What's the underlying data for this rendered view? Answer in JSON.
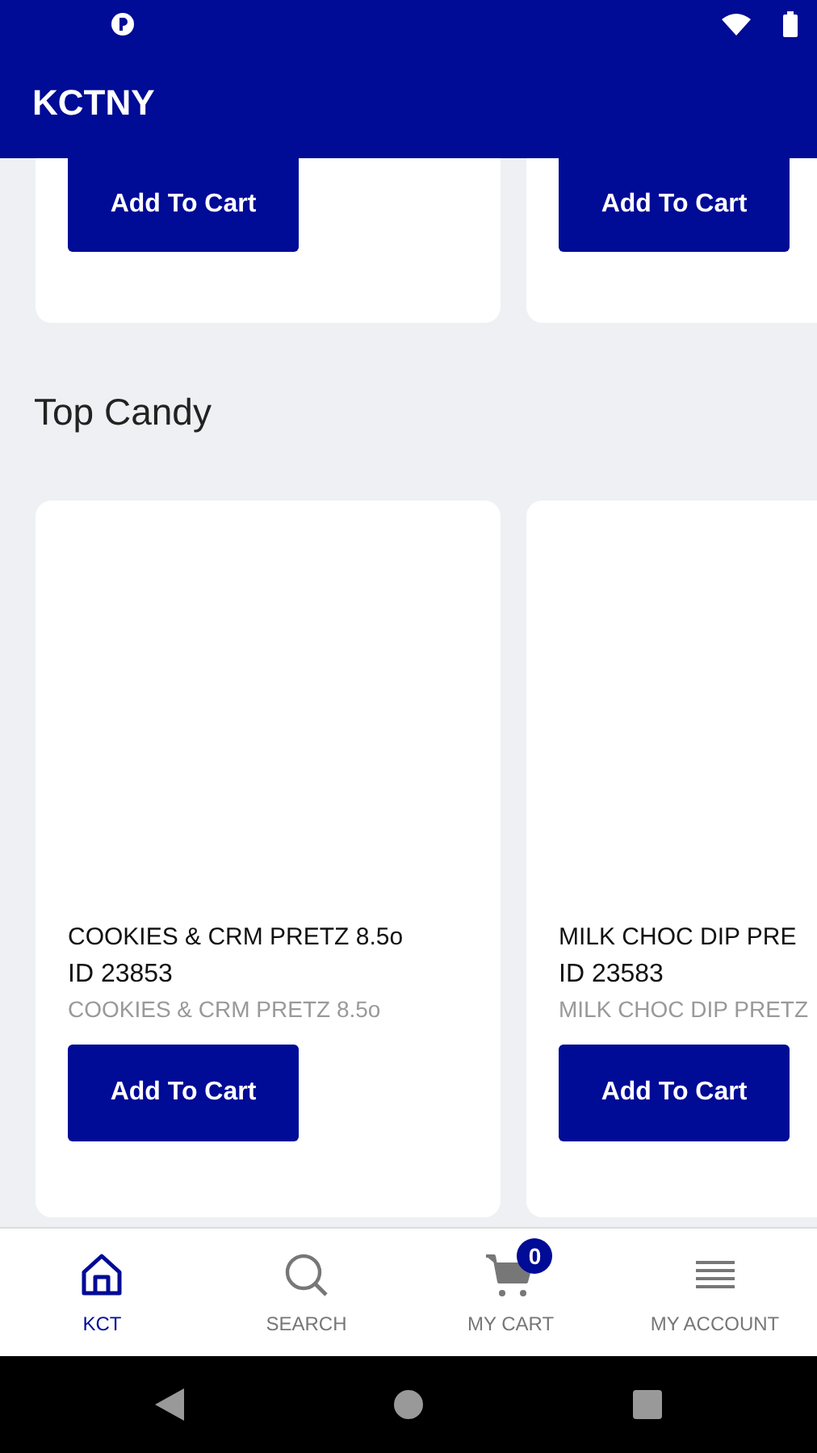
{
  "app_bar": {
    "title": "KCTNY"
  },
  "top_row": [
    {
      "button": "Add To Cart"
    },
    {
      "button": "Add To Cart"
    }
  ],
  "section": {
    "title": "Top Candy",
    "products": [
      {
        "name": "COOKIES & CRM PRETZ 8.5o",
        "id": "ID 23853",
        "description": "COOKIES & CRM PRETZ 8.5o",
        "button": "Add To Cart"
      },
      {
        "name": "MILK CHOC DIP PRE",
        "id": "ID 23583",
        "description": "MILK CHOC DIP PRETZ",
        "button": "Add To Cart"
      }
    ]
  },
  "bottom_nav": [
    {
      "kind": "home",
      "label": "KCT",
      "selected": true
    },
    {
      "kind": "search",
      "label": "SEARCH",
      "selected": false
    },
    {
      "kind": "cart",
      "label": "MY CART",
      "selected": false,
      "badge": "0"
    },
    {
      "kind": "menu",
      "label": "MY ACCOUNT",
      "selected": false
    }
  ]
}
